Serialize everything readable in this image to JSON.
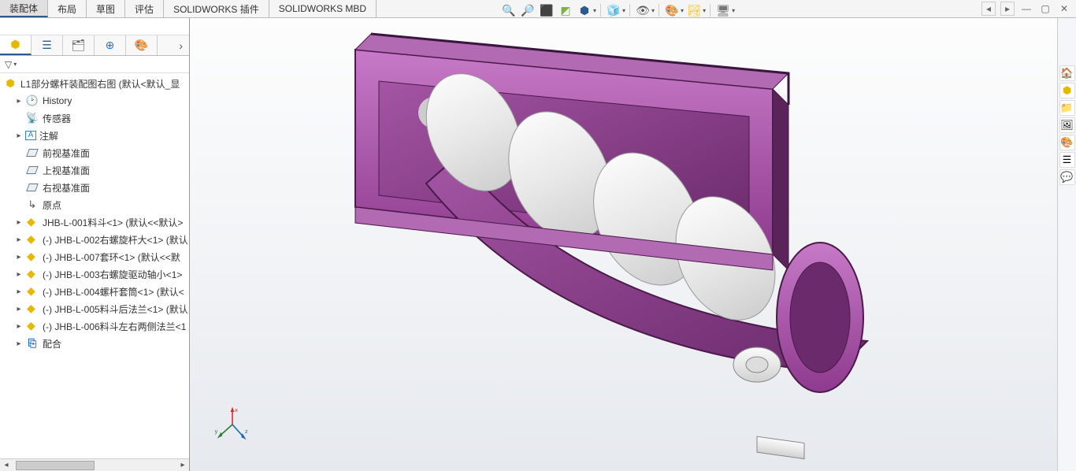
{
  "menu": {
    "tabs": [
      "装配体",
      "布局",
      "草图",
      "评估",
      "SOLIDWORKS 插件",
      "SOLIDWORKS MBD"
    ],
    "active_index": 0
  },
  "view_toolbar": {
    "icons": [
      "zoom-fit",
      "zoom-area",
      "prev-view",
      "section",
      "view-orient",
      "display-style",
      "hide-show",
      "edit-appearance",
      "apply-scene",
      "view-settings"
    ]
  },
  "window_controls": [
    "prev-doc",
    "next-doc",
    "minimize",
    "maximize",
    "close"
  ],
  "panel_tabs": [
    "feature-manager",
    "property-manager",
    "config-manager",
    "dimxpert",
    "display-manager"
  ],
  "filter_placeholder": "",
  "tree": {
    "root": "L1部分螺杆装配图右图  (默认<默认_显",
    "items": [
      {
        "icon": "history",
        "label": "History",
        "expandable": true,
        "indent": 1
      },
      {
        "icon": "sensor",
        "label": "传感器",
        "expandable": false,
        "indent": 1
      },
      {
        "icon": "annotation",
        "label": "注解",
        "expandable": true,
        "indent": 1
      },
      {
        "icon": "plane",
        "label": "前视基准面",
        "expandable": false,
        "indent": 2
      },
      {
        "icon": "plane",
        "label": "上视基准面",
        "expandable": false,
        "indent": 2
      },
      {
        "icon": "plane",
        "label": "右视基准面",
        "expandable": false,
        "indent": 2
      },
      {
        "icon": "origin",
        "label": "原点",
        "expandable": false,
        "indent": 2
      },
      {
        "icon": "part",
        "label": "JHB-L-001料斗<1> (默认<<默认>",
        "expandable": true,
        "indent": 1
      },
      {
        "icon": "part",
        "label": "(-) JHB-L-002右螺旋杆大<1> (默认",
        "expandable": true,
        "indent": 1
      },
      {
        "icon": "part",
        "label": "(-) JHB-L-007套环<1> (默认<<默",
        "expandable": true,
        "indent": 1
      },
      {
        "icon": "part",
        "label": "(-) JHB-L-003右螺旋驱动轴小<1>",
        "expandable": true,
        "indent": 1
      },
      {
        "icon": "part",
        "label": "(-) JHB-L-004螺杆套筒<1> (默认<",
        "expandable": true,
        "indent": 1
      },
      {
        "icon": "part",
        "label": "(-) JHB-L-005料斗后法兰<1> (默认",
        "expandable": true,
        "indent": 1
      },
      {
        "icon": "part",
        "label": "(-) JHB-L-006料斗左右两侧法兰<1",
        "expandable": true,
        "indent": 1
      },
      {
        "icon": "mate",
        "label": "配合",
        "expandable": true,
        "indent": 1
      }
    ]
  },
  "triad": {
    "x": "x",
    "y": "y",
    "z": "z"
  },
  "right_bar": [
    "home",
    "part",
    "open",
    "save",
    "appearance",
    "list",
    "forum"
  ],
  "colors": {
    "model_primary": "#8e3a8e",
    "model_light": "#eeeeee",
    "accent": "#2a5b8b"
  }
}
